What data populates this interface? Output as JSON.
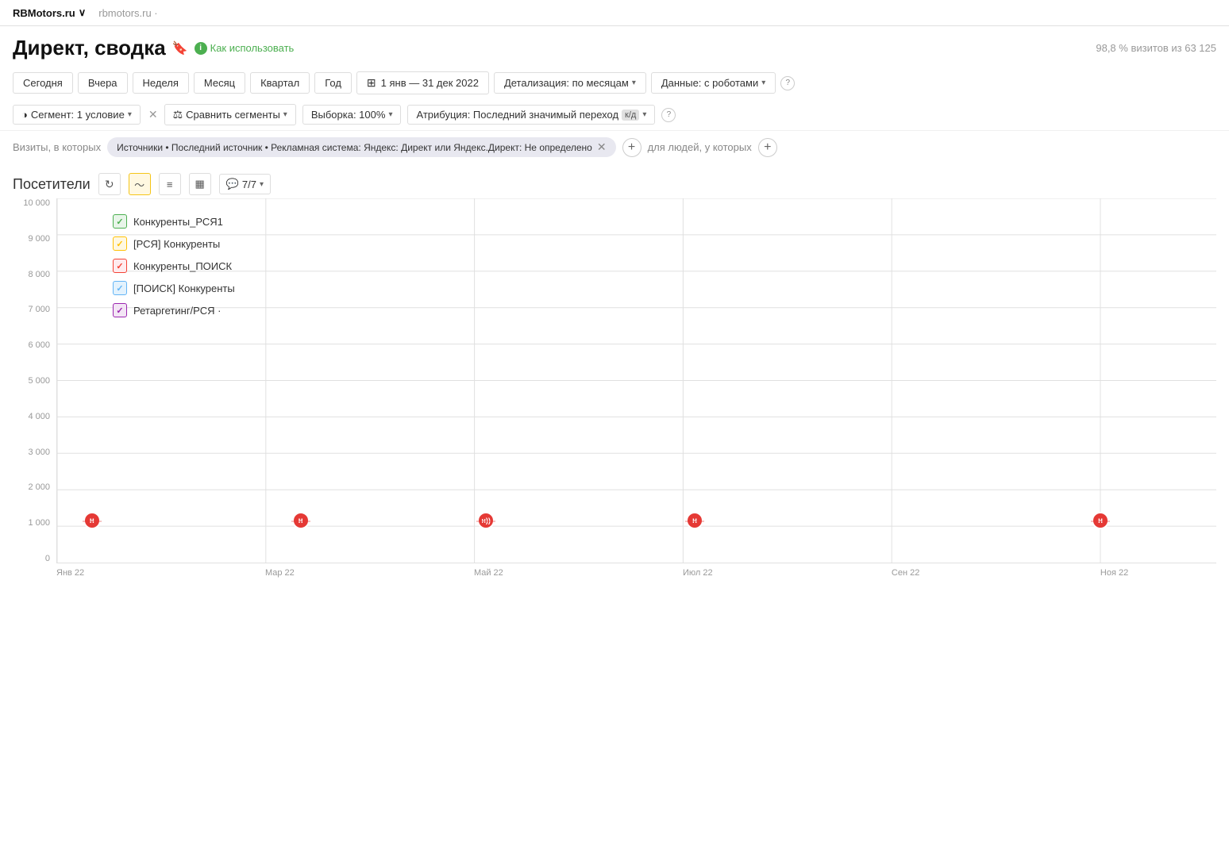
{
  "topbar": {
    "brand": "RBMotors.ru",
    "brand_arrow": "∨",
    "url": "rbmotors.ru ·"
  },
  "header": {
    "title": "Директ, сводка",
    "help_text": "Как использовать",
    "visit_stat": "98,8 % визитов из 63 125"
  },
  "filters": {
    "today": "Сегодня",
    "yesterday": "Вчера",
    "week": "Неделя",
    "month": "Месяц",
    "quarter": "Квартал",
    "year": "Год",
    "date_range": "1 янв — 31 дек 2022",
    "detail": "Детализация: по месяцам",
    "data": "Данные: с роботами"
  },
  "segment": {
    "label": "Сегмент: 1 условие",
    "compare": "Сравнить сегменты",
    "sample": "Выборка: 100%",
    "attribution": "Атрибуция: Последний значимый переход",
    "kd": "к/д"
  },
  "segment_filter": {
    "prefix": "Визиты, в которых",
    "tag": "Источники • Последний источник • Рекламная система: Яндекс: Директ или Яндекс.Директ: Не определено",
    "people_prefix": "для людей, у которых"
  },
  "visitors_section": {
    "title": "Посетители",
    "comments_label": "7/7"
  },
  "chart": {
    "y_labels": [
      "10 000",
      "9 000",
      "8 000",
      "7 000",
      "6 000",
      "5 000",
      "4 000",
      "3 000",
      "2 000",
      "1 000",
      "0"
    ],
    "x_labels": [
      {
        "label": "Янв 22",
        "pct": 0
      },
      {
        "label": "Мар 22",
        "pct": 18
      },
      {
        "label": "Май 22",
        "pct": 36
      },
      {
        "label": "Июл 22",
        "pct": 54
      },
      {
        "label": "Сен 22",
        "pct": 72
      },
      {
        "label": "Ноя 22",
        "pct": 90
      }
    ],
    "legend": [
      {
        "label": "Конкуренты_РСЯ1",
        "color": "#4caf50",
        "bg": "#e8f5e9",
        "check_color": "#4caf50"
      },
      {
        "label": "[РСЯ] Конкуренты",
        "color": "#ffc107",
        "bg": "#fff8e1",
        "check_color": "#ffc107"
      },
      {
        "label": "Конкуренты_ПОИСК",
        "color": "#f44336",
        "bg": "#ffebee",
        "check_color": "#f44336"
      },
      {
        "label": "[ПОИСК] Конкуренты",
        "color": "#64b5f6",
        "bg": "#e3f2fd",
        "check_color": "#64b5f6"
      },
      {
        "label": "Ретаргетинг/РСЯ ·",
        "color": "#9c27b0",
        "bg": "#f3e5f5",
        "check_color": "#9c27b0"
      }
    ],
    "notifications": [
      {
        "x_pct": 3,
        "label": "н"
      },
      {
        "x_pct": 21,
        "label": "н"
      },
      {
        "x_pct": 37,
        "label": "н)"
      },
      {
        "x_pct": 55,
        "label": "н"
      },
      {
        "x_pct": 90,
        "label": "н"
      }
    ]
  }
}
